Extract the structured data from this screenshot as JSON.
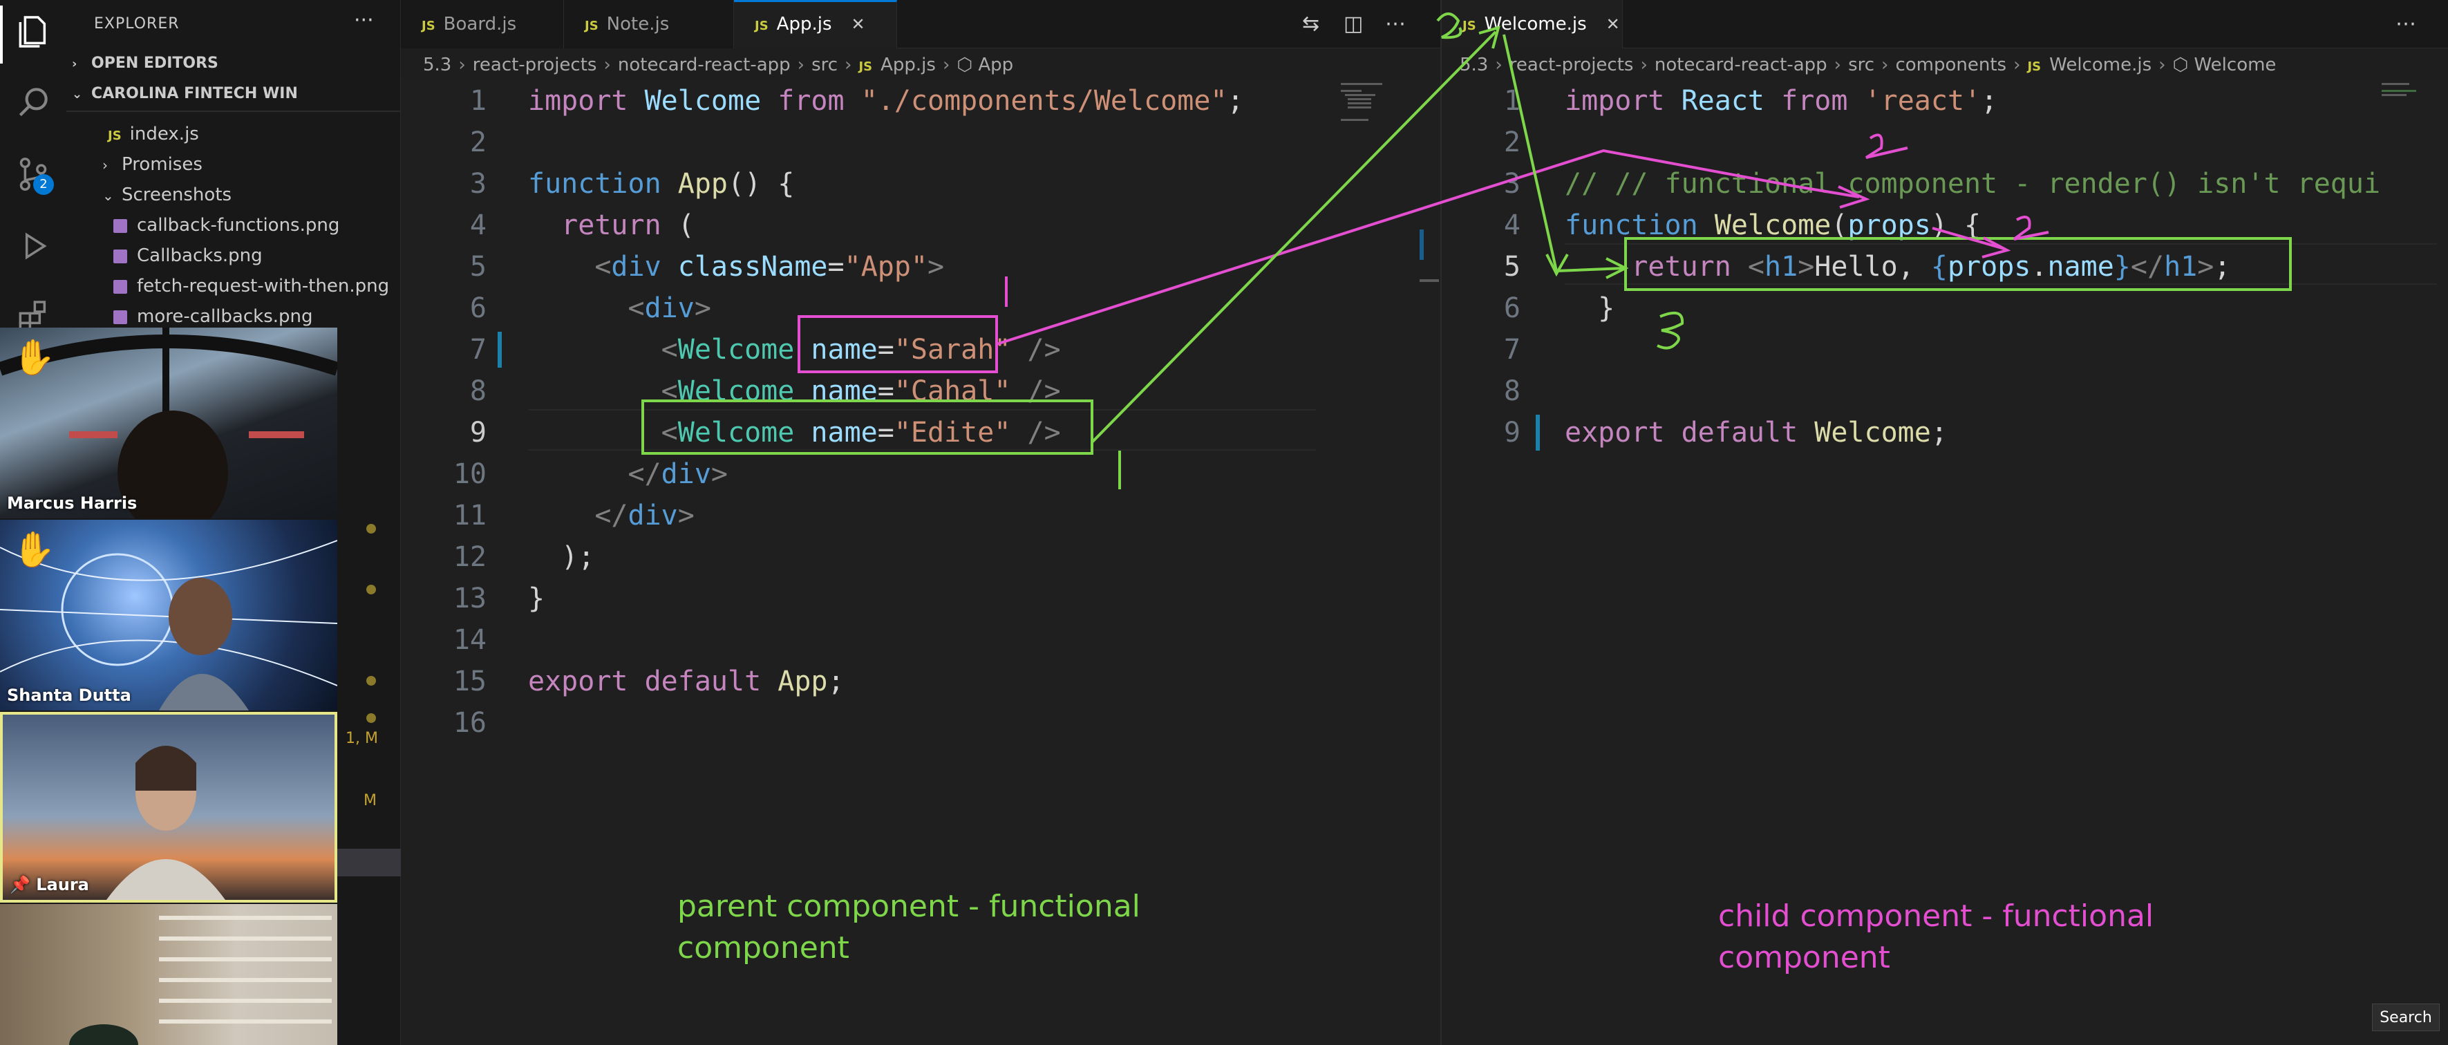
{
  "activity_bar": {
    "icons": [
      "files-icon",
      "search-icon",
      "source-control-icon",
      "run-debug-icon",
      "extensions-icon"
    ],
    "scm_badge": "2"
  },
  "sidebar": {
    "title": "EXPLORER",
    "more": "···",
    "open_editors": "OPEN EDITORS",
    "workspace": "CAROLINA FINTECH WIN",
    "items": [
      {
        "label": "index.js",
        "type": "js"
      },
      {
        "label": "Promises",
        "type": "folder"
      },
      {
        "label": "Screenshots",
        "type": "folder-open"
      },
      {
        "label": "callback-functions.png",
        "type": "png"
      },
      {
        "label": "Callbacks.png",
        "type": "png"
      },
      {
        "label": "fetch-request-with-then.png",
        "type": "png"
      },
      {
        "label": "more-callbacks.png",
        "type": "png"
      }
    ],
    "markers": [
      "1, M",
      "M"
    ]
  },
  "participants": [
    {
      "name": "Marcus Harris",
      "raised_hand": true
    },
    {
      "name": "Shanta Dutta",
      "raised_hand": true
    },
    {
      "name": "Laura",
      "pinned": true
    },
    {
      "name": ""
    }
  ],
  "left_editor": {
    "tabs": [
      {
        "label": "Board.js",
        "icon": "JS",
        "active": false
      },
      {
        "label": "Note.js",
        "icon": "JS",
        "active": false
      },
      {
        "label": "App.js",
        "icon": "JS",
        "active": true,
        "close": "✕"
      }
    ],
    "breadcrumb": [
      "5.3",
      "react-projects",
      "notecard-react-app",
      "src",
      "App.js",
      "App"
    ],
    "line_numbers": [
      "1",
      "2",
      "3",
      "4",
      "5",
      "6",
      "7",
      "8",
      "9",
      "10",
      "11",
      "12",
      "13",
      "14",
      "15",
      "16"
    ],
    "current_line": "9"
  },
  "right_editor": {
    "tabs": [
      {
        "label": "Welcome.js",
        "icon": "JS",
        "active": true,
        "close": "✕"
      }
    ],
    "breadcrumb": [
      "5.3",
      "react-projects",
      "notecard-react-app",
      "src",
      "components",
      "Welcome.js",
      "Welcome"
    ],
    "line_numbers": [
      "1",
      "2",
      "3",
      "4",
      "5",
      "6",
      "7",
      "8",
      "9"
    ],
    "current_line": "5"
  },
  "annotations": {
    "parent_note": "parent component - functional component",
    "child_note": "child component  - functional component",
    "pink_color": "#e34fd0",
    "green_color": "#7ed64a"
  },
  "search_button": "Search"
}
